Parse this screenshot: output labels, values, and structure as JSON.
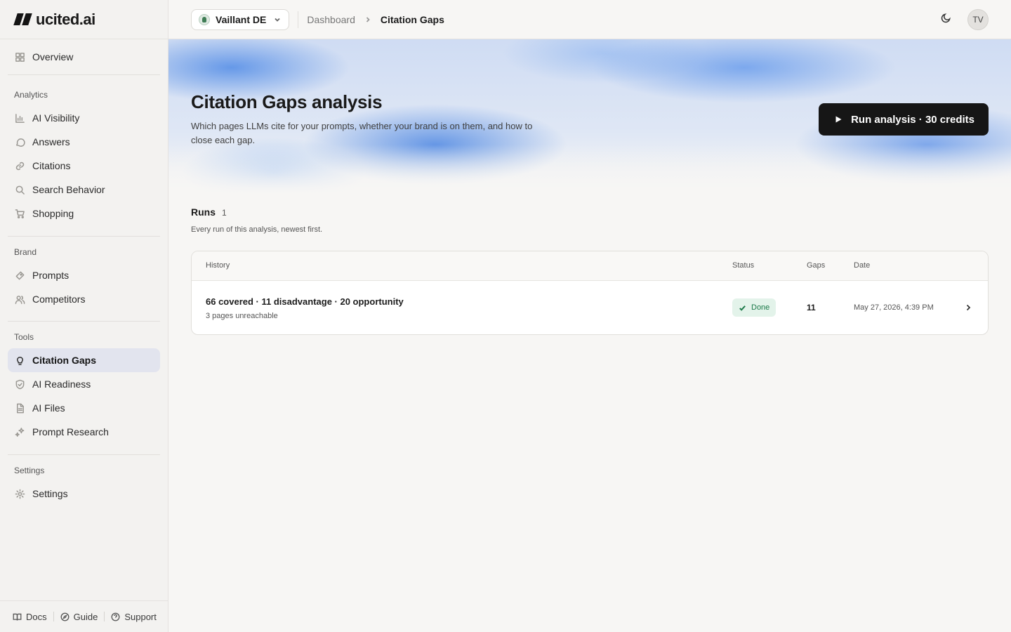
{
  "app": {
    "logo_text": "ucited.ai"
  },
  "sidebar": {
    "overview": "Overview",
    "sections": {
      "analytics": "Analytics",
      "brand": "Brand",
      "tools": "Tools",
      "settings": "Settings"
    },
    "analytics_items": [
      "AI Visibility",
      "Answers",
      "Citations",
      "Search Behavior",
      "Shopping"
    ],
    "brand_items": [
      "Prompts",
      "Competitors"
    ],
    "tools_items": [
      "Citation Gaps",
      "AI Readiness",
      "AI Files",
      "Prompt Research"
    ],
    "settings_items": [
      "Settings"
    ],
    "active_item": "Citation Gaps",
    "footer": {
      "docs": "Docs",
      "guide": "Guide",
      "support": "Support"
    }
  },
  "topbar": {
    "project": "Vaillant DE",
    "breadcrumb": [
      "Dashboard",
      "Citation Gaps"
    ],
    "avatar_initials": "TV"
  },
  "hero": {
    "title": "Citation Gaps analysis",
    "subtitle": "Which pages LLMs cite for your prompts, whether your brand is on them, and how to close each gap.",
    "run_button": "Run analysis · 30 credits"
  },
  "runs": {
    "title": "Runs",
    "count": "1",
    "description": "Every run of this analysis, newest first.",
    "columns": {
      "history": "History",
      "status": "Status",
      "gaps": "Gaps",
      "date": "Date"
    },
    "rows": [
      {
        "summary": "66 covered · 11 disadvantage · 20 opportunity",
        "detail": "3 pages unreachable",
        "status": "Done",
        "gaps": "11",
        "date": "May 27, 2026, 4:39 PM"
      }
    ]
  },
  "colors": {
    "accent_dark": "#161616",
    "active_nav_bg": "#e2e4ee",
    "status_done": "#1d7a4a",
    "status_done_bg": "#e3f3ea"
  }
}
